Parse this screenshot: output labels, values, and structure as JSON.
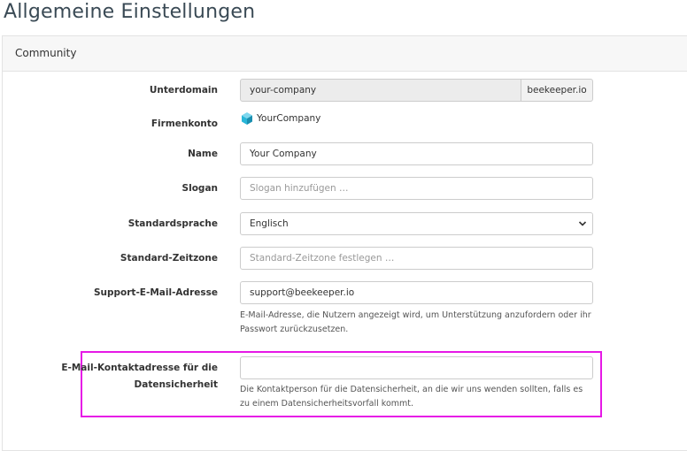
{
  "page": {
    "title": "Allgemeine Einstellungen"
  },
  "panel": {
    "title": "Community"
  },
  "fields": {
    "subdomain": {
      "label": "Unterdomain",
      "value": "your-company",
      "suffix": "beekeeper.io"
    },
    "company_account": {
      "label": "Firmenkonto",
      "value": "YourCompany"
    },
    "name": {
      "label": "Name",
      "value": "Your Company"
    },
    "slogan": {
      "label": "Slogan",
      "placeholder": "Slogan hinzufügen …"
    },
    "language": {
      "label": "Standardsprache",
      "value": "Englisch"
    },
    "timezone": {
      "label": "Standard-Zeitzone",
      "placeholder": "Standard-Zeitzone festlegen …"
    },
    "support_email": {
      "label": "Support-E-Mail-Adresse",
      "value": "support@beekeeper.io",
      "help_line1": "E-Mail-Adresse, die Nutzern angezeigt wird, um Unterstützung anzufordern oder ihr",
      "help_line2": "Passwort zurückzusetzen."
    },
    "privacy_email": {
      "label_line1": "E-Mail-Kontaktadresse für die",
      "label_line2": "Datensicherheit",
      "value": "",
      "help_line1": "Die Kontaktperson für die Datensicherheit, an die wir uns wenden sollten, falls es",
      "help_line2": "zu einem Datensicherheitsvorfall kommt."
    }
  },
  "colors": {
    "highlight": "#e619e6",
    "logo": "#29b6d8"
  },
  "icons": {
    "company_logo": "cube-logo-icon",
    "select": "chevron-down-icon"
  }
}
